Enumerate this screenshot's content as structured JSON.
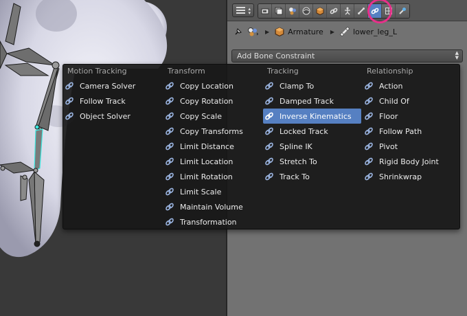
{
  "breadcrumb": {
    "object_label": "Armature",
    "bone_label": "lower_leg_L"
  },
  "properties": {
    "add_constraint_label": "Add Bone Constraint",
    "tabs": [
      {
        "name": "render-tab",
        "icon": "camera-icon",
        "active": false
      },
      {
        "name": "render-layers-tab",
        "icon": "layers-icon",
        "active": false
      },
      {
        "name": "scene-tab",
        "icon": "scene-icon",
        "active": false
      },
      {
        "name": "world-tab",
        "icon": "world-icon",
        "active": false
      },
      {
        "name": "object-tab",
        "icon": "cube-icon",
        "active": false
      },
      {
        "name": "object-constraints-tab",
        "icon": "chain-link-icon",
        "active": false
      },
      {
        "name": "object-data-tab",
        "icon": "armature-icon",
        "active": false
      },
      {
        "name": "bone-tab",
        "icon": "bone-icon",
        "active": false
      },
      {
        "name": "bone-constraints-tab",
        "icon": "bone-constraint-icon",
        "active": true
      },
      {
        "name": "modifiers-tab",
        "icon": "grid-icon",
        "active": false
      },
      {
        "name": "physics-tab",
        "icon": "physics-icon",
        "active": false
      }
    ]
  },
  "menu": {
    "columns": [
      {
        "heading": "Motion Tracking",
        "items": [
          "Camera Solver",
          "Follow Track",
          "Object Solver"
        ]
      },
      {
        "heading": "Transform",
        "items": [
          "Copy Location",
          "Copy Rotation",
          "Copy Scale",
          "Copy Transforms",
          "Limit Distance",
          "Limit Location",
          "Limit Rotation",
          "Limit Scale",
          "Maintain Volume",
          "Transformation"
        ]
      },
      {
        "heading": "Tracking",
        "items": [
          "Clamp To",
          "Damped Track",
          "Inverse Kinematics",
          "Locked Track",
          "Spline IK",
          "Stretch To",
          "Track To"
        ],
        "active_item": "Inverse Kinematics"
      },
      {
        "heading": "Relationship",
        "items": [
          "Action",
          "Child Of",
          "Floor",
          "Follow Path",
          "Pivot",
          "Rigid Body Joint",
          "Shrinkwrap"
        ]
      }
    ]
  },
  "colors": {
    "menu_bg": "#181818",
    "active_item": "#5680c2",
    "highlight_ring": "#e8308a",
    "selected_bone_outline": "#3ce8e0"
  }
}
